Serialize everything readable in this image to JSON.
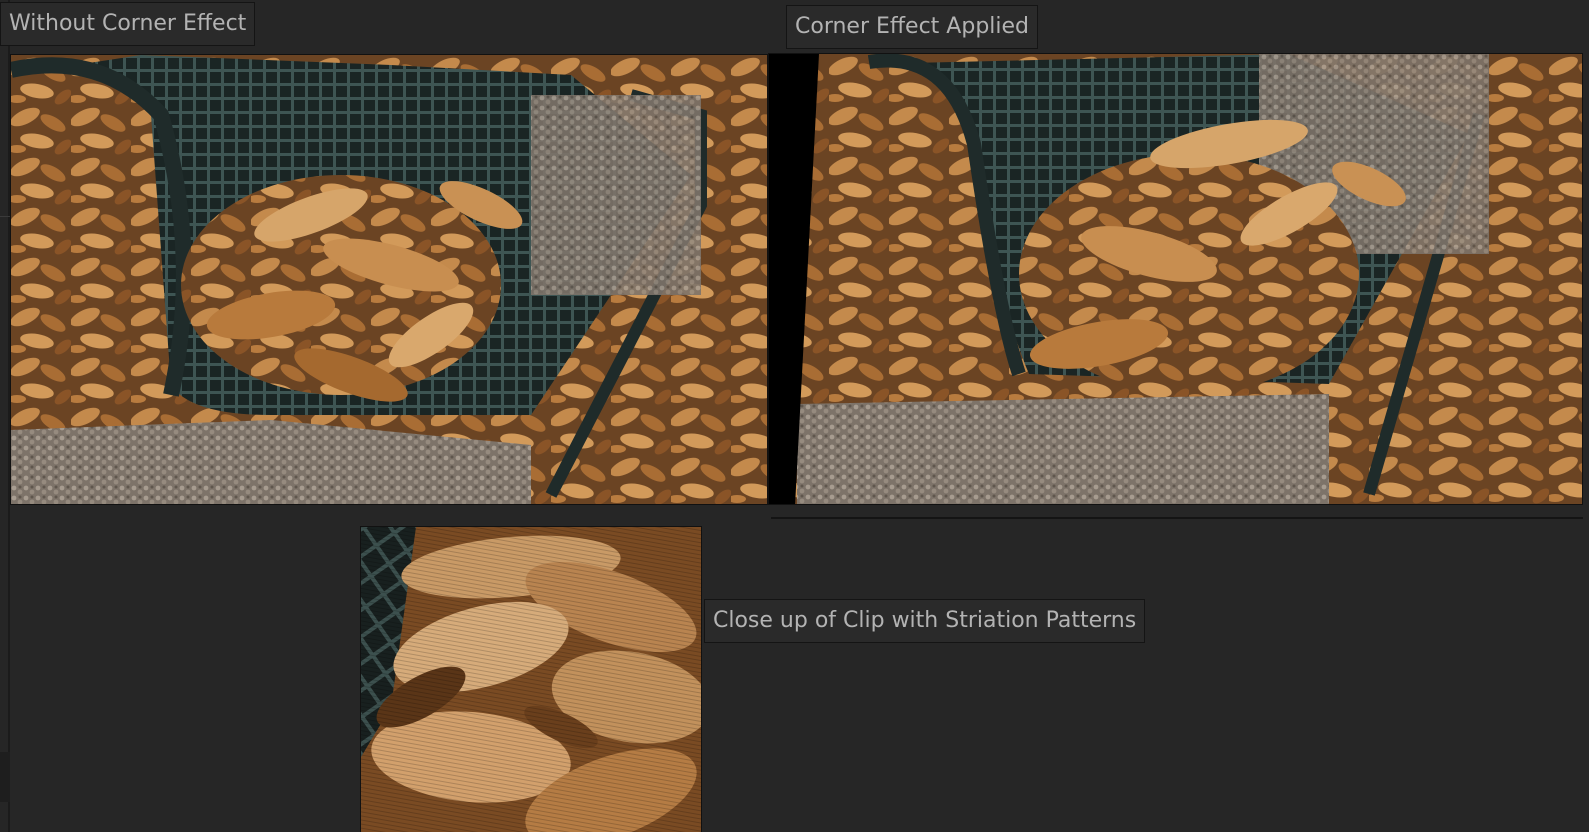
{
  "labels": {
    "left": "Without Corner Effect",
    "right": "Corner Effect Applied",
    "closeup": "Close up of Clip with Striation Patterns"
  },
  "colors": {
    "background": "#262626",
    "label_bg": "#2a2a2a",
    "label_text": "#b3b3b3",
    "bench": "#2c3c3a",
    "leaf": "#b07a3e",
    "concrete": "#8c8276"
  }
}
